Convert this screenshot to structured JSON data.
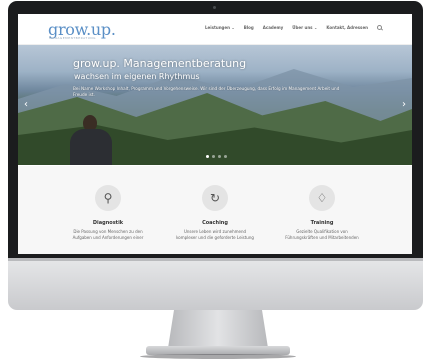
{
  "site": {
    "logo": "grow.up.",
    "logo_tagline": "MANAGEMENTBERATUNG"
  },
  "nav": {
    "items": [
      "Leistungen ⌄",
      "Blog",
      "Academy",
      "Über uns ⌄",
      "Kontakt, Adressen"
    ],
    "search_icon": "search-icon"
  },
  "hero": {
    "title": "grow.up. Managementberatung",
    "subtitle": "wachsen im eigenen Rhythmus",
    "text": "Bei Name Workshop Inhalt, Programm und Vorgehensweise. Wir sind der Überzeugung, dass Erfolg im Management Arbeit und Freude ist.",
    "slide_count": 4,
    "active_slide": 1
  },
  "services": [
    {
      "icon": "search-icon",
      "glyph": "⚲",
      "title": "Diagnostik",
      "desc_line1": "Die Passung von Menschen zu den",
      "desc_line2": "Aufgaben und Anforderungen einer"
    },
    {
      "icon": "refresh-icon",
      "glyph": "↻",
      "title": "Coaching",
      "desc_line1": "Unsere Leben wird zunehmend",
      "desc_line2": "komplexer und die geforderte Leistung"
    },
    {
      "icon": "lightbulb-icon",
      "glyph": "♢",
      "title": "Training",
      "desc_line1": "Gezielte Qualifikation von",
      "desc_line2": "Führungskräften und Mitarbeitenden"
    }
  ],
  "colors": {
    "logo": "#5a8fc6",
    "bezel": "#1b1c1e",
    "services_bg": "#f7f7f7"
  }
}
